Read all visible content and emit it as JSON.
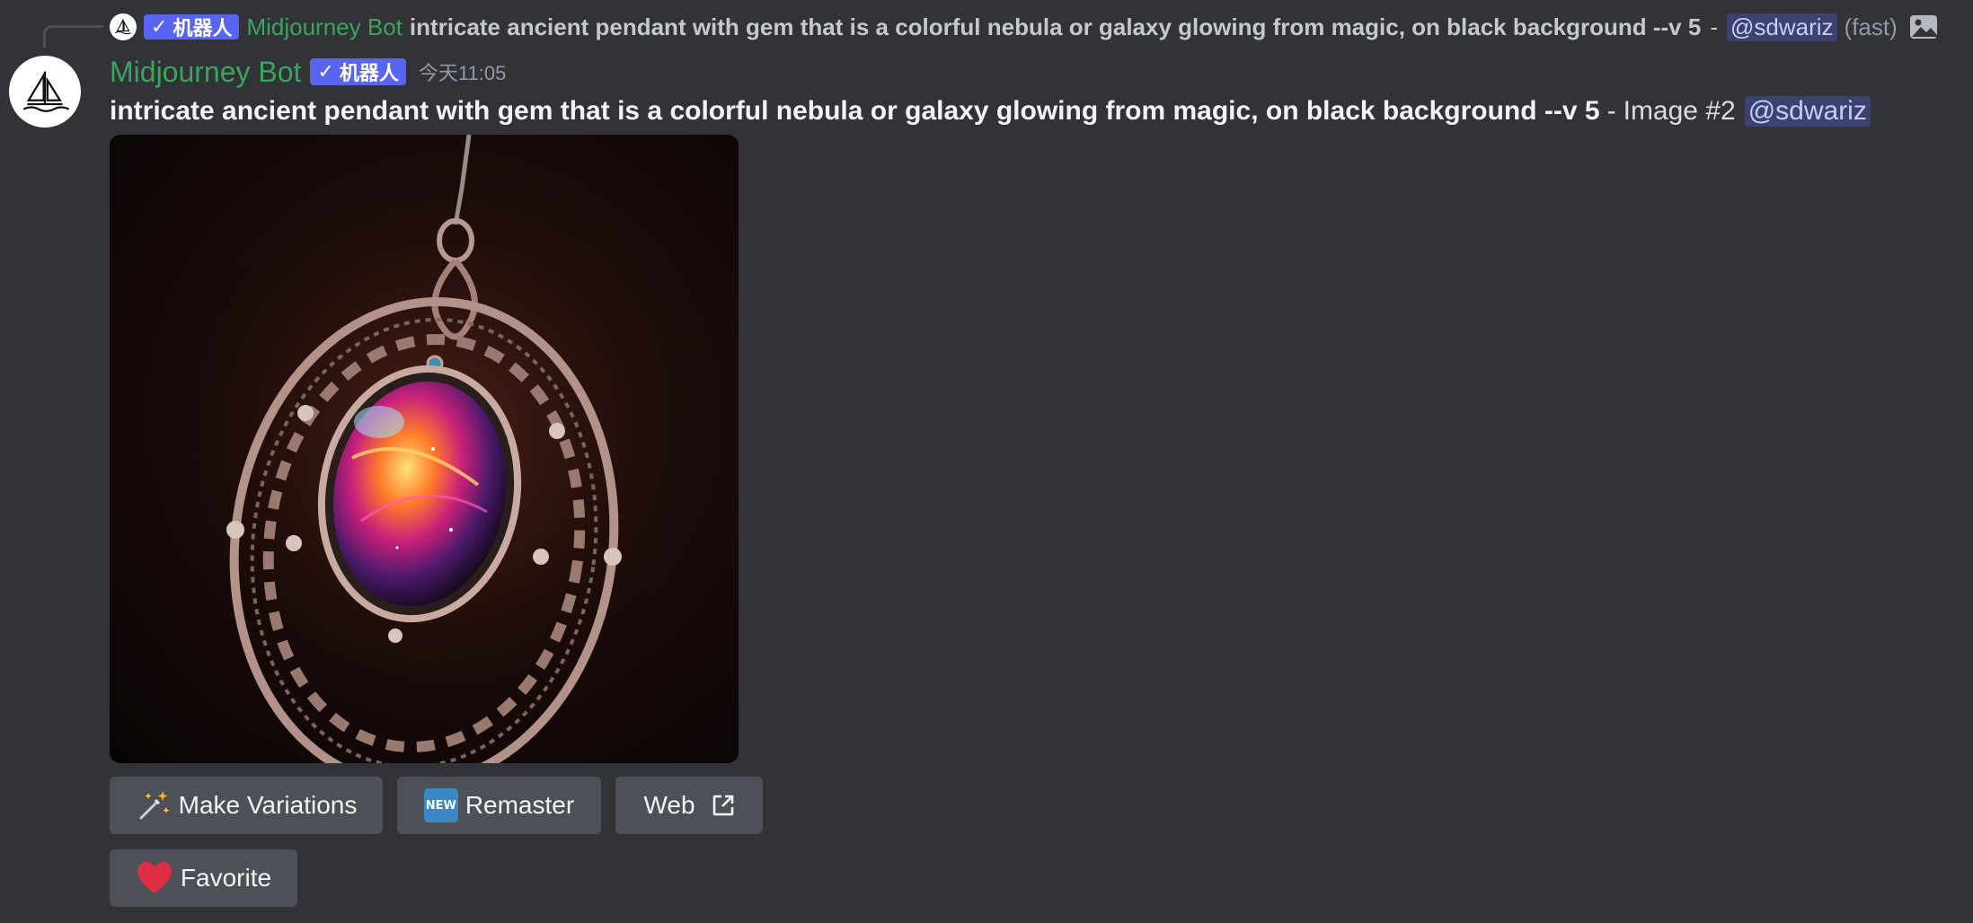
{
  "reply": {
    "bot_badge": "机器人",
    "author": "Midjourney Bot",
    "text": "intricate ancient pendant with gem that is a colorful nebula or galaxy glowing from magic, on black background --v 5",
    "separator": "-",
    "mention": "@sdwariz",
    "speed": "(fast)"
  },
  "message": {
    "author": "Midjourney Bot",
    "bot_badge": "机器人",
    "timestamp": "今天11:05",
    "prompt": "intricate ancient pendant with gem that is a colorful nebula or galaxy glowing from magic, on black background --v 5",
    "separator": "-",
    "image_label": "Image #2",
    "mention": "@sdwariz"
  },
  "buttons": {
    "make_variations": "Make Variations",
    "remaster": "Remaster",
    "remaster_badge": "NEW",
    "web": "Web",
    "favorite": "Favorite"
  },
  "icons": {
    "avatar": "sailboat-icon",
    "variations": "magic-wand-icon",
    "remaster": "new-badge-icon",
    "web": "external-link-icon",
    "favorite": "heart-icon",
    "attachment": "image-icon"
  },
  "colors": {
    "background": "#313338",
    "author": "#3ba55c",
    "bot_badge": "#5865f2",
    "button": "#4e5058",
    "mention_bg": "rgba(88,101,242,0.3)"
  }
}
